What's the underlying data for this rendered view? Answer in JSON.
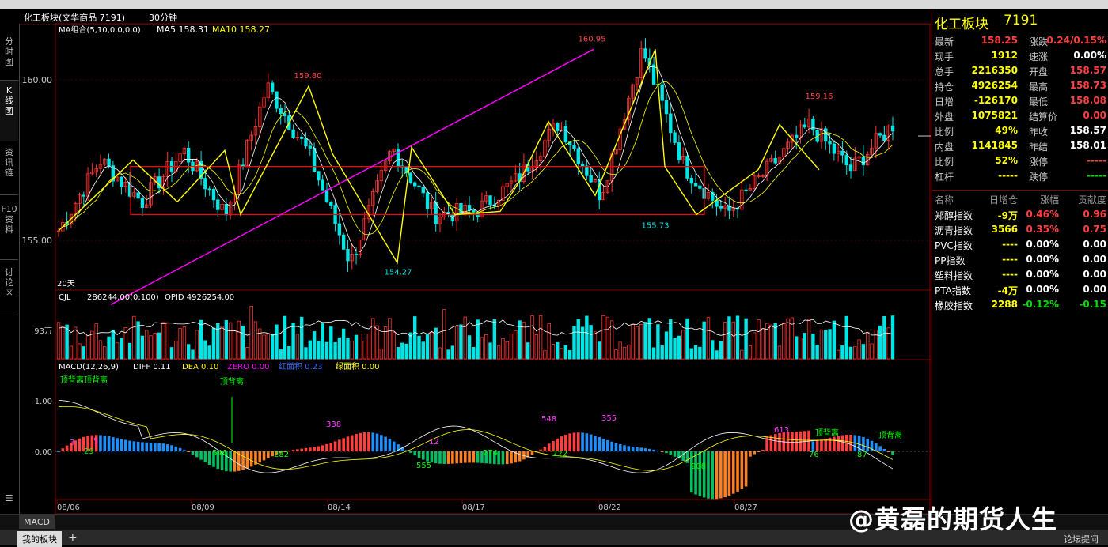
{
  "title_bar": {
    "symbol_label": "化工板块(文华商品 7191)",
    "period": "30分钟"
  },
  "left_tabs": [
    {
      "label": "分\n时\n图"
    },
    {
      "label": "K\n线\n图"
    },
    {
      "label": "资\n讯\n链"
    },
    {
      "label": "F10\n资\n料"
    },
    {
      "label": "讨\n论\n区"
    }
  ],
  "main_legend": {
    "ma_group": "MA组合(5,10,0,0,0,0)",
    "ma5": "MA5 158.31",
    "ma10": "MA10 158.27",
    "bars_label": "20天"
  },
  "volume_legend": {
    "cjl": "CJL",
    "cjl_val": "286244.00(0:100)",
    "opid": "OPID 4926254.00",
    "axis": "93万"
  },
  "macd_legend": {
    "macd": "MACD(12,26,9)",
    "diff": "DIFF 0.11",
    "dea": "DEA 0.10",
    "zero": "ZERO 0.00",
    "red_area": "红面积 0.23",
    "green_area": "绿面积 0.00"
  },
  "colors": {
    "up": "#ff3232",
    "down": "#00e5e5",
    "ma5": "#ffffff",
    "ma10": "#ffff00",
    "trend": "#ff00ff",
    "zigzag": "#ffff00",
    "box": "#ff0000",
    "macd_red": "#ff4040",
    "macd_green": "#00c060",
    "macd_orange": "#ff8020",
    "macd_blue": "#2090ff"
  },
  "chart_data": [
    {
      "type": "candlestick",
      "title": "化工板块",
      "price_axis": [
        "160.00",
        "155.00"
      ],
      "ylim": [
        153.5,
        161.5
      ],
      "x_labels": [
        "08/06",
        "08/09",
        "08/14",
        "08/17",
        "08/22",
        "08/27"
      ],
      "annotations": [
        {
          "text": "160.95",
          "value": 160.95,
          "kind": "high"
        },
        {
          "text": "159.80",
          "value": 159.8,
          "kind": "high"
        },
        {
          "text": "159.16",
          "value": 159.16,
          "kind": "high"
        },
        {
          "text": "154.27",
          "value": 154.27,
          "kind": "low"
        },
        {
          "text": "155.73",
          "value": 155.73,
          "kind": "low"
        }
      ],
      "zigzag": [
        155.3,
        157.5,
        156.2,
        157.8,
        155.8,
        159.8,
        157.7,
        154.3,
        157.9,
        155.8,
        155.9,
        156.9,
        158.7,
        156.4,
        160.95,
        157.3,
        155.8,
        157.2,
        158.6,
        157.2,
        158.6
      ],
      "box": {
        "top": 157.3,
        "bottom": 155.8
      },
      "trendline": {
        "from": 153.0,
        "to": 160.95
      }
    },
    {
      "type": "bar",
      "title": "CJL",
      "ylabel": "93万"
    },
    {
      "type": "bar",
      "title": "MACD",
      "y_axis": [
        "1.00",
        "0.00"
      ],
      "annotations": [
        "顶背离顶背离",
        "顶背离",
        "3",
        "5",
        "29",
        "546",
        "282",
        "338",
        "12",
        "555",
        "274",
        "548",
        "222",
        "355",
        "908",
        "613",
        "76",
        "87",
        "顶背离",
        "顶背离"
      ]
    }
  ],
  "info_panel": {
    "name": "化工板块",
    "code": "7191",
    "rows": [
      {
        "l1": "最新",
        "v1": "158.25",
        "c1": "#ff4040",
        "l2": "涨跌",
        "v2": "0.24/0.15%",
        "c2": "#ff4040"
      },
      {
        "l1": "现手",
        "v1": "1912",
        "c1": "#ffff00",
        "l2": "速涨",
        "v2": "0.00%",
        "c2": "#ffffff"
      },
      {
        "l1": "总手",
        "v1": "2216350",
        "c1": "#ffff00",
        "l2": "开盘",
        "v2": "158.57",
        "c2": "#ff4040"
      },
      {
        "l1": "持仓",
        "v1": "4926254",
        "c1": "#ffff00",
        "l2": "最高",
        "v2": "158.73",
        "c2": "#ff4040"
      },
      {
        "l1": "日增",
        "v1": "-126170",
        "c1": "#ffff00",
        "l2": "最低",
        "v2": "158.08",
        "c2": "#ff4040"
      },
      {
        "l1": "外盘",
        "v1": "1075821",
        "c1": "#ffff00",
        "l2": "结算价",
        "v2": "0.00",
        "c2": "#ff4040"
      },
      {
        "l1": "比例",
        "v1": "49%",
        "c1": "#ffff00",
        "l2": "昨收",
        "v2": "158.57",
        "c2": "#ffffff"
      },
      {
        "l1": "内盘",
        "v1": "1141845",
        "c1": "#ffff00",
        "l2": "昨结",
        "v2": "158.01",
        "c2": "#ffffff"
      },
      {
        "l1": "比例",
        "v1": "52%",
        "c1": "#ffff00",
        "l2": "涨停",
        "v2": "-----",
        "c2": "#ff4040"
      },
      {
        "l1": "杠杆",
        "v1": "-----",
        "c1": "#ffff00",
        "l2": "跌停",
        "v2": "-----",
        "c2": "#00e000"
      }
    ],
    "table_headers": [
      "名称",
      "日增仓",
      "涨幅",
      "贡献度"
    ],
    "table_rows": [
      {
        "name": "郑醇指数",
        "inc": "-9万",
        "chg": "0.46%",
        "con": "0.96",
        "col": "#ff4040"
      },
      {
        "name": "沥青指数",
        "inc": "3566",
        "chg": "0.35%",
        "con": "0.75",
        "col": "#ff4040"
      },
      {
        "name": "PVC指数",
        "inc": "----",
        "chg": "0.00%",
        "con": "0.00",
        "col": "#ffffff"
      },
      {
        "name": "PP指数",
        "inc": "----",
        "chg": "0.00%",
        "con": "0.00",
        "col": "#ffffff"
      },
      {
        "name": "塑料指数",
        "inc": "----",
        "chg": "0.00%",
        "con": "0.00",
        "col": "#ffffff"
      },
      {
        "name": "PTA指数",
        "inc": "-4万",
        "chg": "0.00%",
        "con": "0.00",
        "col": "#ffffff"
      },
      {
        "name": "橡胶指数",
        "inc": "2288",
        "chg": "-0.12%",
        "con": "-0.15",
        "col": "#00e000"
      }
    ]
  },
  "bottom": {
    "tab_macd": "MACD",
    "tab_myboard": "我的板块",
    "add": "+",
    "forum": "论坛提问"
  },
  "watermark": "@黄磊的期货人生"
}
